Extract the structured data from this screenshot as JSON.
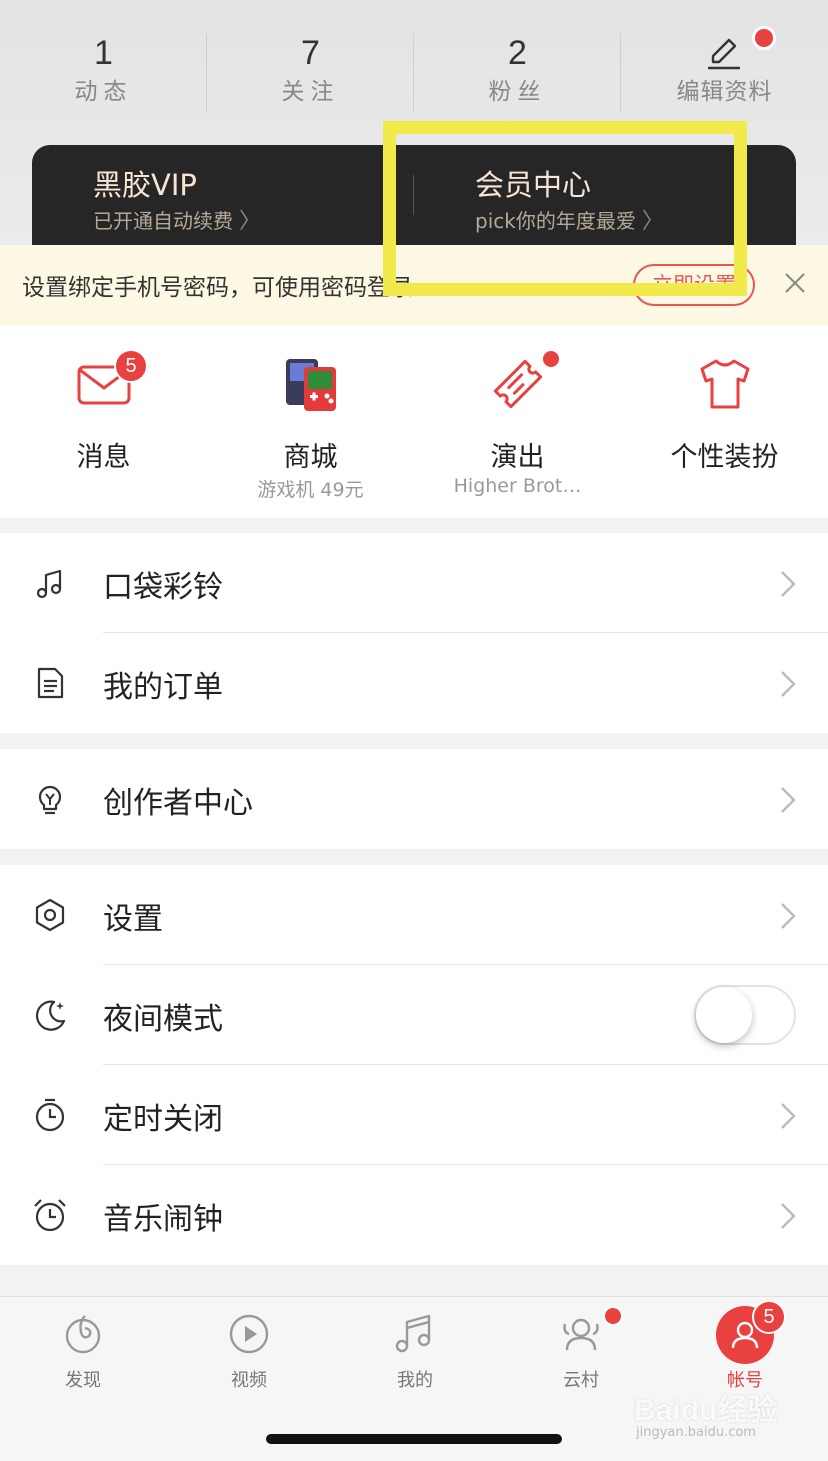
{
  "stats": [
    {
      "value": "1",
      "label": "动态"
    },
    {
      "value": "7",
      "label": "关注"
    },
    {
      "value": "2",
      "label": "粉丝"
    }
  ],
  "edit_profile": {
    "label": "编辑资料",
    "icon": "pencil-icon"
  },
  "vip": {
    "title": "黑胶VIP",
    "subtitle": "已开通自动续费"
  },
  "member_center": {
    "title": "会员中心",
    "subtitle": "pick你的年度最爱"
  },
  "notice": {
    "text": "设置绑定手机号密码，可使用密码登录",
    "button": "立即设置"
  },
  "quick_grid": [
    {
      "label": "消息",
      "sub": "",
      "badge": "5",
      "icon": "mail-icon"
    },
    {
      "label": "商城",
      "sub": "游戏机 49元",
      "icon": "game-console-icon"
    },
    {
      "label": "演出",
      "sub": "Higher Brot…",
      "icon": "ticket-icon"
    },
    {
      "label": "个性装扮",
      "sub": "",
      "icon": "tshirt-icon"
    }
  ],
  "menu_sections": {
    "s1": [
      {
        "label": "口袋彩铃",
        "icon": "ringtone-icon"
      },
      {
        "label": "我的订单",
        "icon": "order-icon"
      }
    ],
    "s2": [
      {
        "label": "创作者中心",
        "icon": "lightbulb-icon"
      }
    ],
    "s3": [
      {
        "label": "设置",
        "icon": "settings-icon"
      },
      {
        "label": "夜间模式",
        "icon": "moon-icon",
        "toggle": false
      },
      {
        "label": "定时关闭",
        "icon": "timer-icon"
      },
      {
        "label": "音乐闹钟",
        "icon": "alarm-icon"
      }
    ]
  },
  "tabs": [
    {
      "label": "发现",
      "icon": "discover-icon"
    },
    {
      "label": "视频",
      "icon": "video-icon"
    },
    {
      "label": "我的",
      "icon": "music-note-icon"
    },
    {
      "label": "云村",
      "icon": "community-icon"
    },
    {
      "label": "帐号",
      "icon": "account-icon",
      "badge": "5",
      "active": true
    }
  ],
  "colors": {
    "accent": "#e8413f",
    "vip_bg": "#262626",
    "highlight": "#f1ea4a"
  },
  "watermark": {
    "text": "Baidu经验",
    "sub": "jingyan.baidu.com"
  }
}
